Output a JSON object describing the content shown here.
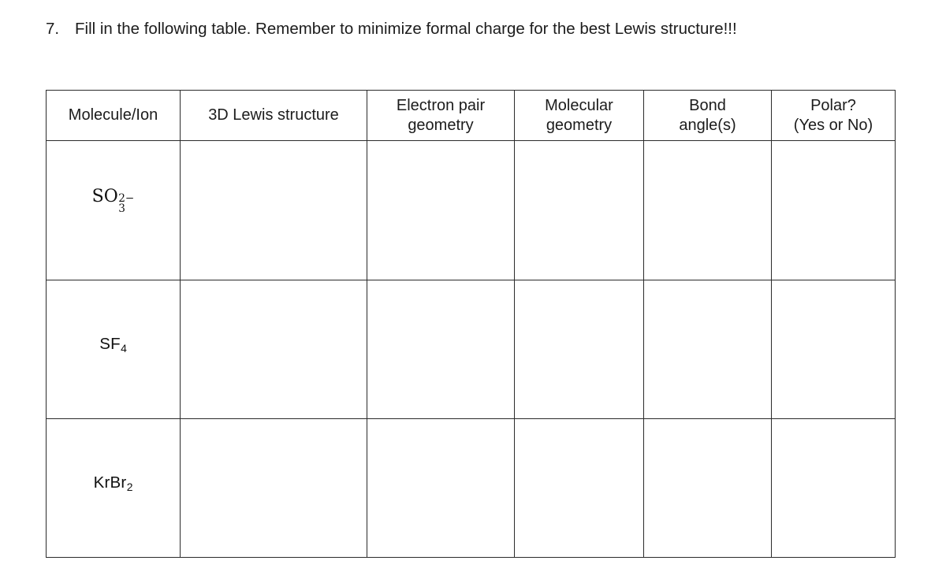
{
  "question": {
    "number": "7.",
    "text": "Fill in the following table.  Remember to minimize formal charge for the best Lewis structure!!!"
  },
  "table": {
    "headers": [
      {
        "line1": "Molecule/Ion",
        "line2": ""
      },
      {
        "line1": "3D Lewis structure",
        "line2": ""
      },
      {
        "line1": "Electron pair",
        "line2": "geometry"
      },
      {
        "line1": "Molecular",
        "line2": "geometry"
      },
      {
        "line1": "Bond",
        "line2": "angle(s)"
      },
      {
        "line1": "Polar?",
        "line2": "(Yes or No)"
      }
    ],
    "rows": [
      {
        "species": {
          "plain": "SO3 2-",
          "base": "SO",
          "superscript": "2−",
          "subscript": "3",
          "style": "math-stacked"
        },
        "lewis_structure": "",
        "electron_pair_geometry": "",
        "molecular_geometry": "",
        "bond_angles": "",
        "polar": ""
      },
      {
        "species": {
          "plain": "SF4",
          "base": "SF",
          "subscript": "4",
          "superscript": "",
          "style": "sans-subscript"
        },
        "lewis_structure": "",
        "electron_pair_geometry": "",
        "molecular_geometry": "",
        "bond_angles": "",
        "polar": ""
      },
      {
        "species": {
          "plain": "KrBr2",
          "base": "KrBr",
          "subscript": "2",
          "superscript": "",
          "style": "sans-subscript"
        },
        "lewis_structure": "",
        "electron_pair_geometry": "",
        "molecular_geometry": "",
        "bond_angles": "",
        "polar": ""
      }
    ]
  },
  "colors": {
    "page_background": "#ffffff",
    "text": "#1c1c1c",
    "table_border": "#2b2b2b"
  }
}
